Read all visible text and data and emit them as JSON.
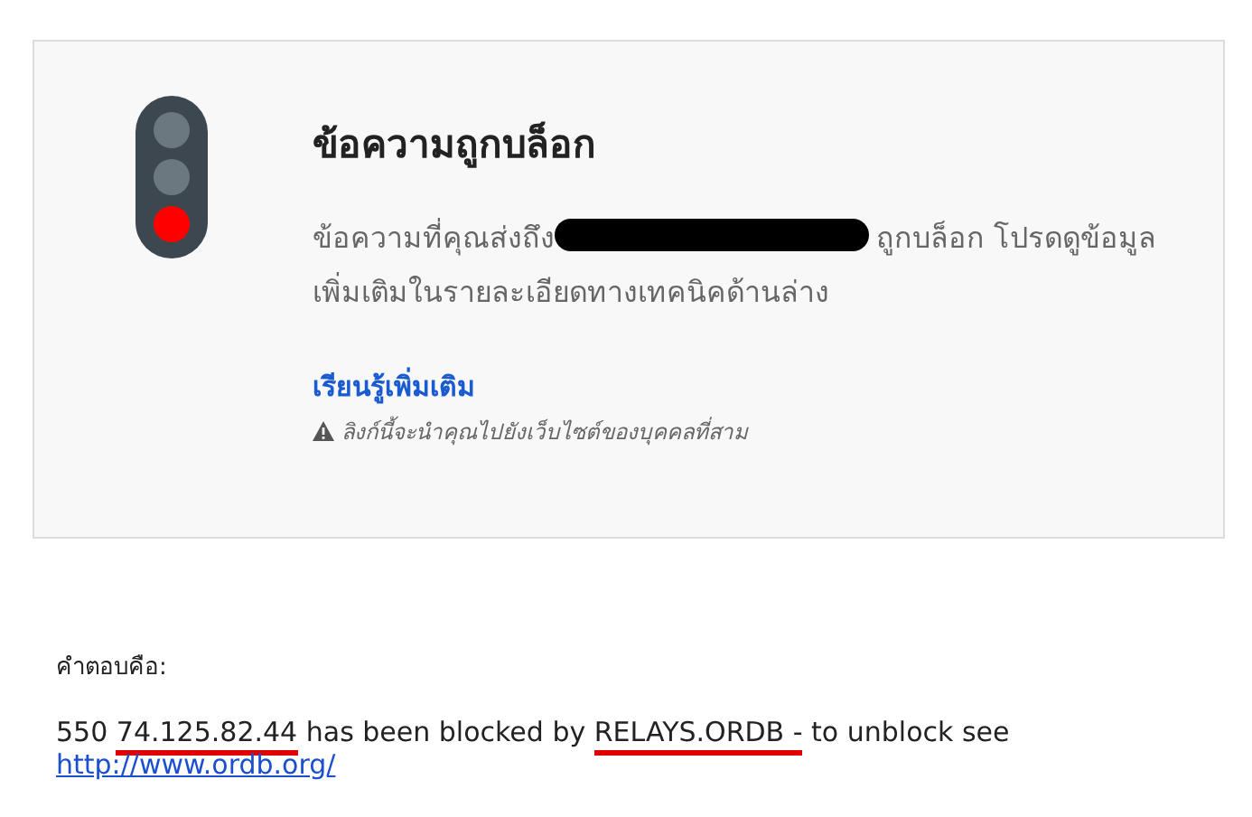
{
  "notice": {
    "title": "ข้อความถูกบล็อก",
    "message_before": "ข้อความที่คุณส่งถึง",
    "message_redacted": true,
    "message_after": "ถูกบล็อก โปรดดูข้อมูลเพิ่มเติมในรายละเอียดทางเทคนิคด้านล่าง",
    "learn_more_link": "เรียนรู้เพิ่มเติม",
    "warning": "ลิงก์นี้จะนำคุณไปยังเว็บไซต์ของบุคคลที่สาม"
  },
  "response": {
    "label": "คำตอบคือ:",
    "segments": [
      {
        "text": "550 ",
        "marked": false
      },
      {
        "text": "74.125.82.44",
        "marked": true
      },
      {
        "text": " has been blocked by ",
        "marked": false
      },
      {
        "text": "RELAYS.ORDB -",
        "marked": true
      },
      {
        "text": " to unblock see",
        "marked": false
      }
    ],
    "link": "http://www.ordb.org/"
  }
}
